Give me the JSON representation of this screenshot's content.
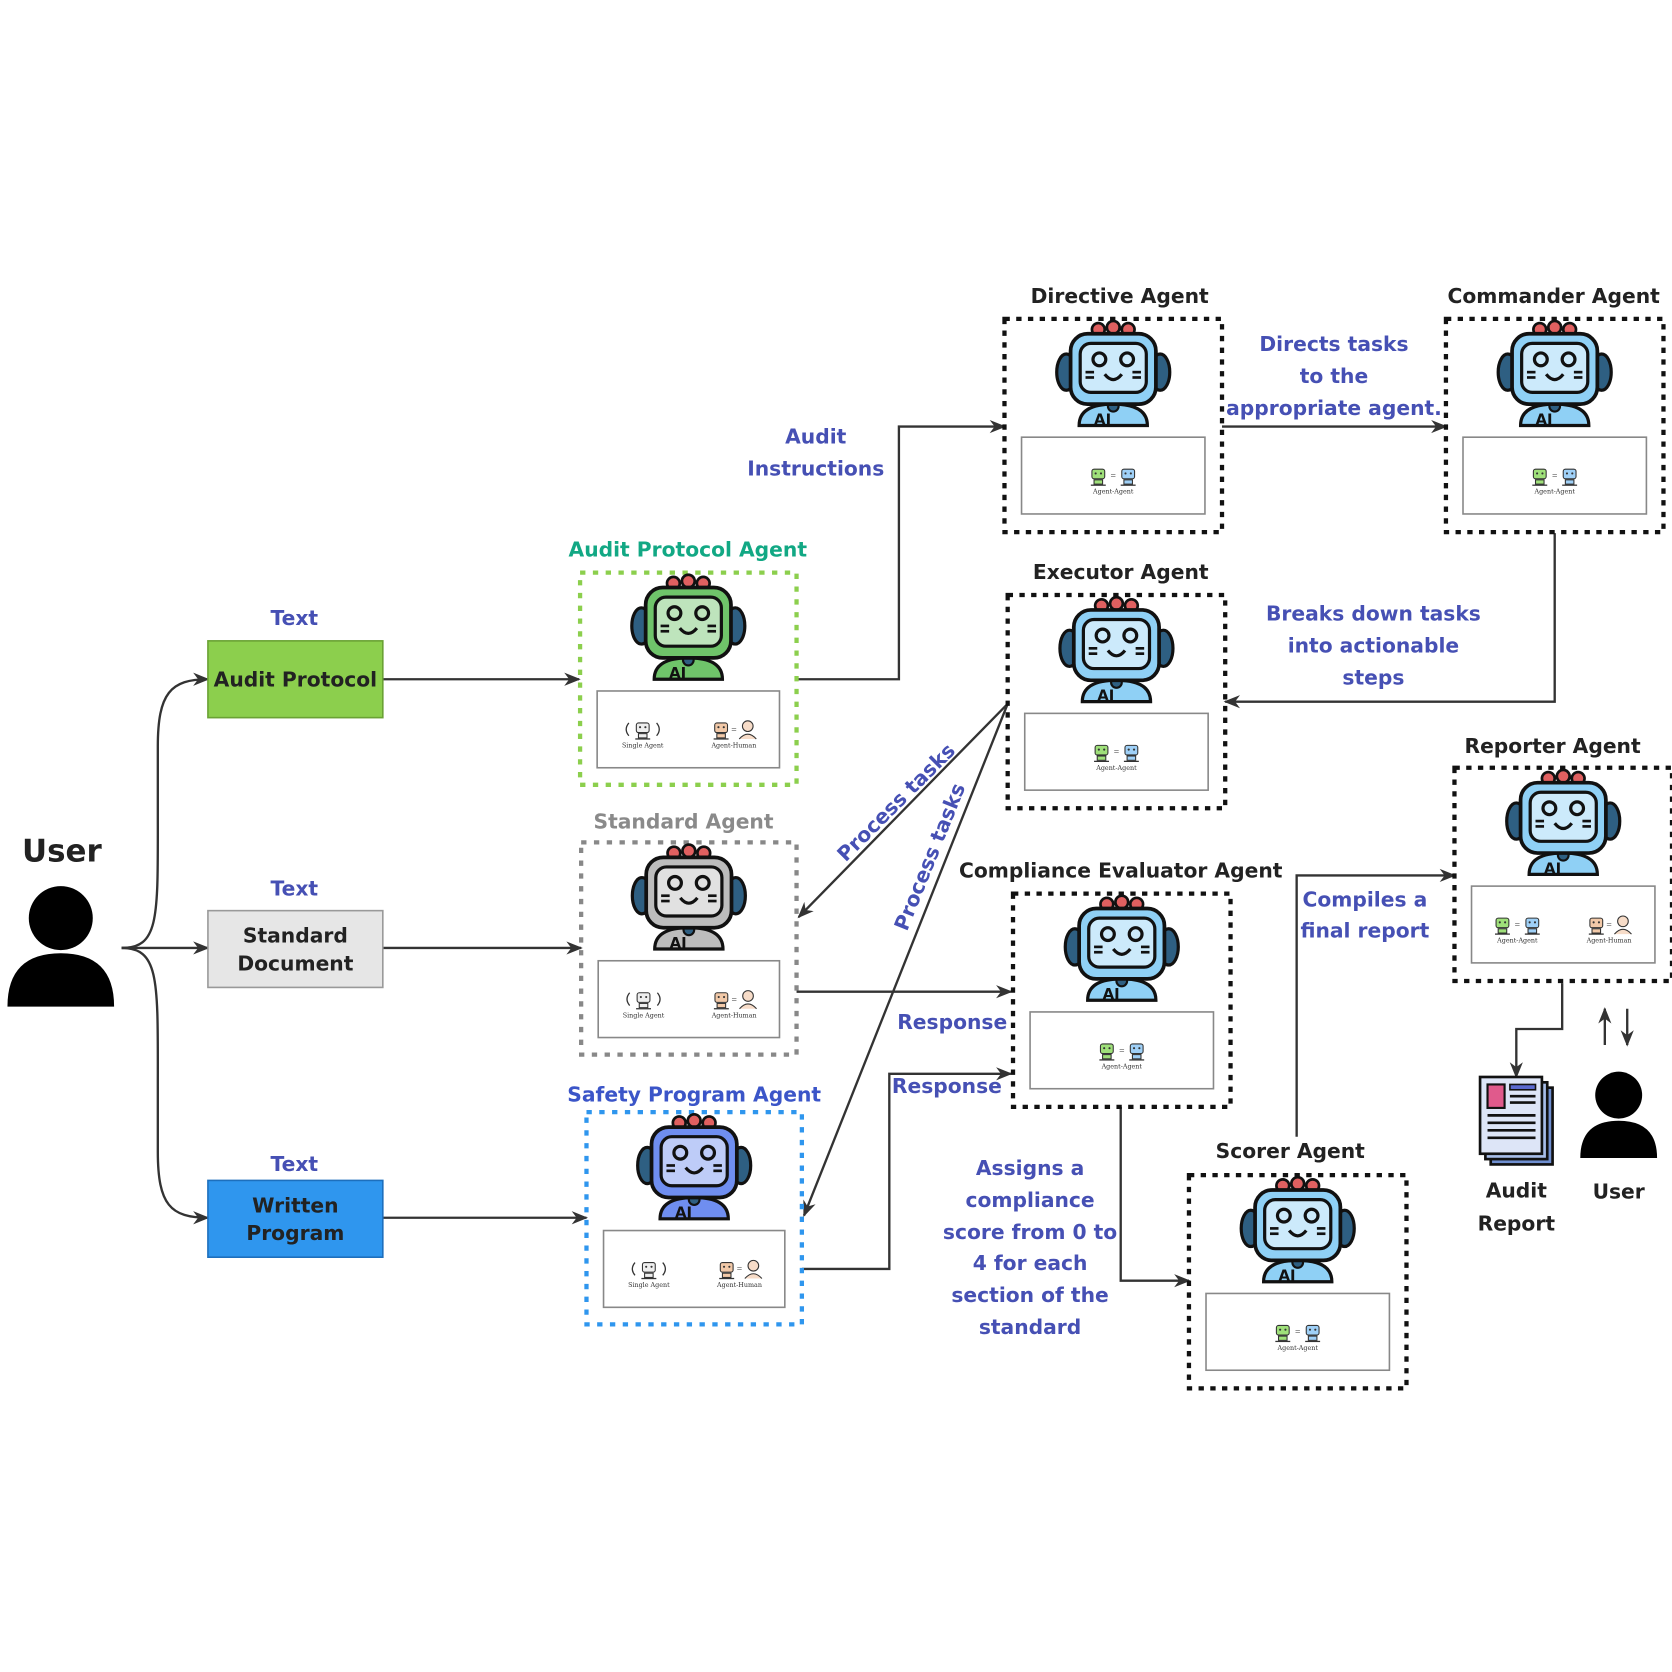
{
  "diagram": {
    "user": {
      "label": "User"
    },
    "inputs": [
      {
        "id": "audit-protocol",
        "type_label": "Text",
        "label_lines": [
          "Audit Protocol"
        ],
        "color": "#8ccf4d"
      },
      {
        "id": "standard-document",
        "type_label": "Text",
        "label_lines": [
          "Standard",
          "Document"
        ],
        "color": "#e6e6e6"
      },
      {
        "id": "written-program",
        "type_label": "Text",
        "label_lines": [
          "Written",
          "Program"
        ],
        "color": "#2f96ee"
      }
    ],
    "agents": {
      "audit_protocol": {
        "title": "Audit Protocol Agent",
        "title_color": "#12a884",
        "border_color": "#8ccf4d",
        "robot_color": "#6fc46a",
        "modes": [
          "Single Agent",
          "Agent-Human"
        ]
      },
      "standard": {
        "title": "Standard Agent",
        "title_color": "#8a8a8a",
        "border_color": "#888888",
        "robot_color": "#bdbdbd",
        "modes": [
          "Single Agent",
          "Agent-Human"
        ]
      },
      "safety_program": {
        "title": "Safety Program Agent",
        "title_color": "#3b55c8",
        "border_color": "#2f96ee",
        "robot_color": "#6f8ef0",
        "modes": [
          "Single Agent",
          "Agent-Human"
        ]
      },
      "directive": {
        "title": "Directive Agent",
        "title_color": "#222222",
        "border_color": "#111111",
        "robot_color": "#8fd0f5",
        "modes": [
          "Agent-Agent"
        ]
      },
      "commander": {
        "title": "Commander Agent",
        "title_color": "#222222",
        "border_color": "#111111",
        "robot_color": "#8fd0f5",
        "modes": [
          "Agent-Agent"
        ]
      },
      "executor": {
        "title": "Executor Agent",
        "title_color": "#222222",
        "border_color": "#111111",
        "robot_color": "#8fd0f5",
        "modes": [
          "Agent-Agent"
        ]
      },
      "compliance": {
        "title": "Compliance Evaluator Agent",
        "title_color": "#222222",
        "border_color": "#111111",
        "robot_color": "#8fd0f5",
        "modes": [
          "Agent-Agent"
        ]
      },
      "scorer": {
        "title": "Scorer Agent",
        "title_color": "#222222",
        "border_color": "#111111",
        "robot_color": "#8fd0f5",
        "modes": [
          "Agent-Agent"
        ]
      },
      "reporter": {
        "title": "Reporter Agent",
        "title_color": "#222222",
        "border_color": "#111111",
        "robot_color": "#8fd0f5",
        "modes": [
          "Agent-Agent",
          "Agent-Human"
        ]
      }
    },
    "edge_labels": {
      "audit_instructions": [
        "Audit",
        "Instructions"
      ],
      "directs_tasks": [
        "Directs tasks",
        "to the",
        "appropriate agent."
      ],
      "breaks_down": [
        "Breaks down tasks",
        "into actionable",
        "steps"
      ],
      "process_tasks_1": "Process tasks",
      "process_tasks_2": "Process tasks",
      "response_1": "Response",
      "response_2": "Response",
      "assigns_score": [
        "Assigns a",
        "compliance",
        "score from 0 to",
        "4 for each",
        "section of the",
        "standard"
      ],
      "compiles_report": [
        "Compiles a",
        "final report"
      ]
    },
    "outputs": {
      "audit_report": {
        "label_lines": [
          "Audit",
          "Report"
        ]
      },
      "end_user": {
        "label": "User"
      }
    },
    "ai_badge": "AI",
    "colors": {
      "note": "#4650b4",
      "line": "#333333",
      "report_accent": "#e05a8c"
    }
  }
}
